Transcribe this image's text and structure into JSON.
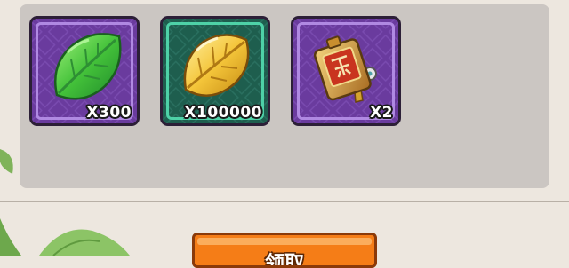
{
  "reward_panel": {
    "items": [
      {
        "name": "green-leaf",
        "icon": "green-leaf-icon",
        "quantity": "X300",
        "frame": "purple"
      },
      {
        "name": "golden-leaf",
        "icon": "golden-leaf-icon",
        "quantity": "X100000",
        "frame": "green"
      },
      {
        "name": "tribute-token",
        "icon": "tribute-token-icon",
        "quantity": "X2",
        "frame": "purple"
      }
    ]
  },
  "claim_button": {
    "label": "领取"
  },
  "colors": {
    "background": "#ede7df",
    "panel": "#cbc6c2",
    "purple_frame": "#6a3b9e",
    "green_frame": "#1e5e4e",
    "button": "#f57d17"
  }
}
